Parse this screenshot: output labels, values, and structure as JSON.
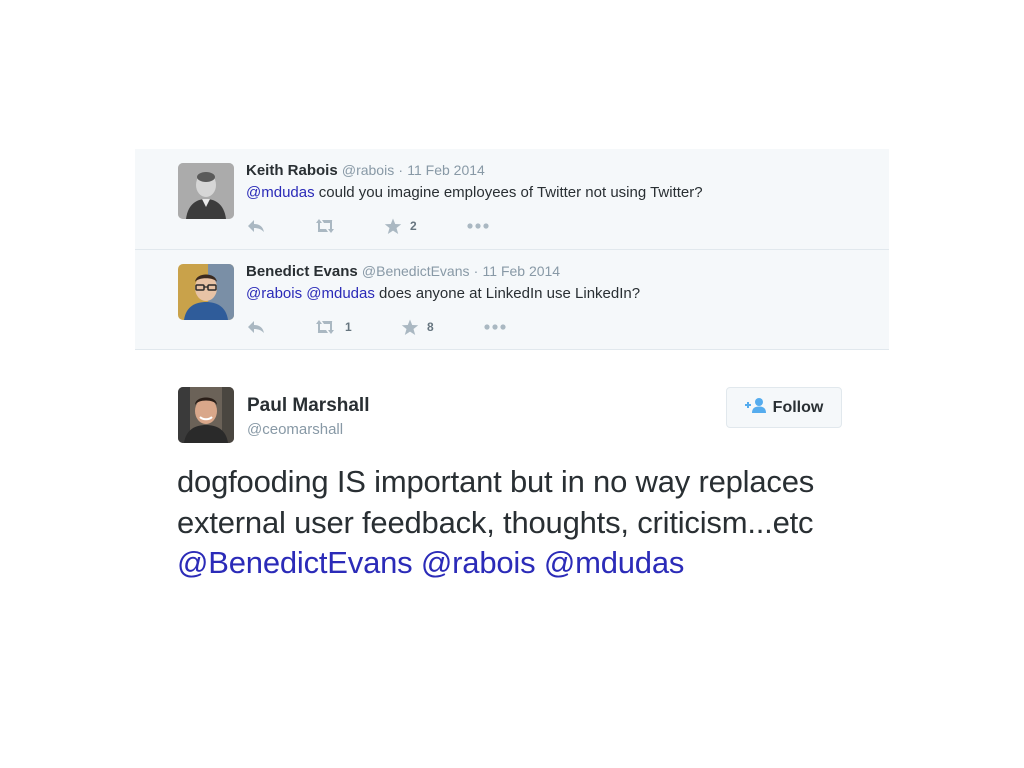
{
  "replies": [
    {
      "name": "Keith Rabois",
      "handle": "@rabois",
      "separator": "·",
      "date": "11 Feb 2014",
      "mentions": [
        "@mdudas"
      ],
      "text": "could you imagine employees of Twitter not using Twitter?",
      "retweet_count": "",
      "favorite_count": "2"
    },
    {
      "name": "Benedict Evans",
      "handle": "@BenedictEvans",
      "separator": "·",
      "date": "11 Feb 2014",
      "mentions": [
        "@rabois",
        "@mdudas"
      ],
      "text": "does anyone at LinkedIn use LinkedIn?",
      "retweet_count": "1",
      "favorite_count": "8"
    }
  ],
  "main_tweet": {
    "name": "Paul Marshall",
    "handle": "@ceomarshall",
    "follow_label": "Follow",
    "text_part1": "dogfooding IS important but in no way replaces external user feedback, thoughts, criticism...etc",
    "mention1": "@BenedictEvans",
    "mention2": "@rabois",
    "mention3": "@mdudas"
  },
  "icons": {
    "reply": "reply-icon",
    "retweet": "retweet-icon",
    "favorite": "star-icon",
    "more": "more-icon",
    "follow": "follow-user-icon"
  },
  "colors": {
    "mention": "#2b2bb8",
    "thread_background": "#f5f8fa",
    "icon_gray": "#aab8c2"
  }
}
